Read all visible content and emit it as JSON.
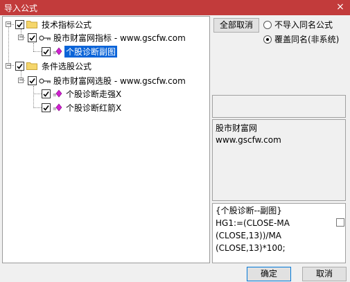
{
  "window": {
    "title": "导入公式",
    "close_icon": "×"
  },
  "tree": {
    "groups": [
      {
        "label": "技术指标公式",
        "child": {
          "label": "股市财富网指标 - www.gscfw.com",
          "items": [
            "个股诊断副图"
          ]
        }
      },
      {
        "label": "条件选股公式",
        "child": {
          "label": "股市财富网选股 - www.gscfw.com",
          "items": [
            "个股诊断走强X",
            "个股诊断红箭X"
          ]
        }
      }
    ]
  },
  "options": {
    "unselect_all": "全部取消",
    "radio1": "不导入同名公式",
    "radio2": "覆盖同名(非系统)",
    "radio_selected": 2
  },
  "info": {
    "line1": "股市财富网",
    "line2": "www.gscfw.com"
  },
  "formula": {
    "text": "{个股诊断--副图}\nHG1:=(CLOSE-MA\n(CLOSE,13))/MA\n(CLOSE,13)*100;"
  },
  "footer": {
    "ok": "确定",
    "cancel": "取消"
  },
  "colors": {
    "titlebar": "#c23b3b",
    "selection": "#0a64d8"
  }
}
